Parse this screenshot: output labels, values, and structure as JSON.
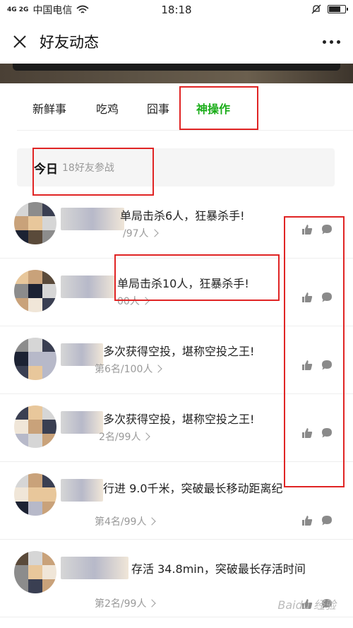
{
  "status_bar": {
    "signal_tag": "4G 2G",
    "carrier": "中国电信",
    "time": "18:18",
    "battery_level": 0.72
  },
  "header": {
    "title": "好友动态",
    "back_icon": "close-icon",
    "more_icon": "more-dots-icon"
  },
  "tabs": [
    {
      "label": "新鲜事",
      "active": false
    },
    {
      "label": "吃鸡",
      "active": false
    },
    {
      "label": "囧事",
      "active": false
    },
    {
      "label": "神操作",
      "active": true
    }
  ],
  "section": {
    "title": "今日",
    "subtitle": "18好友参战"
  },
  "feed": [
    {
      "title": "单局击杀6人，狂暴杀手!",
      "sub": "/97人"
    },
    {
      "title": "单局击杀10人，狂暴杀手!",
      "sub": "00人"
    },
    {
      "title": "多次获得空投，堪称空投之王!",
      "sub": "第6名/100人"
    },
    {
      "title": "多次获得空投，堪称空投之王!",
      "sub": "2名/99人"
    },
    {
      "title": "行进 9.0千米，突破最长移动距离纪",
      "sub": "第4名/99人"
    },
    {
      "title": "存活 34.8min，突破最长存活时间",
      "sub": "第2名/99人"
    }
  ],
  "colors": {
    "accent": "#1aad19",
    "annotation": "#e02424",
    "icon_gray": "#8a8a8a"
  },
  "watermark": "Baidu 经验"
}
